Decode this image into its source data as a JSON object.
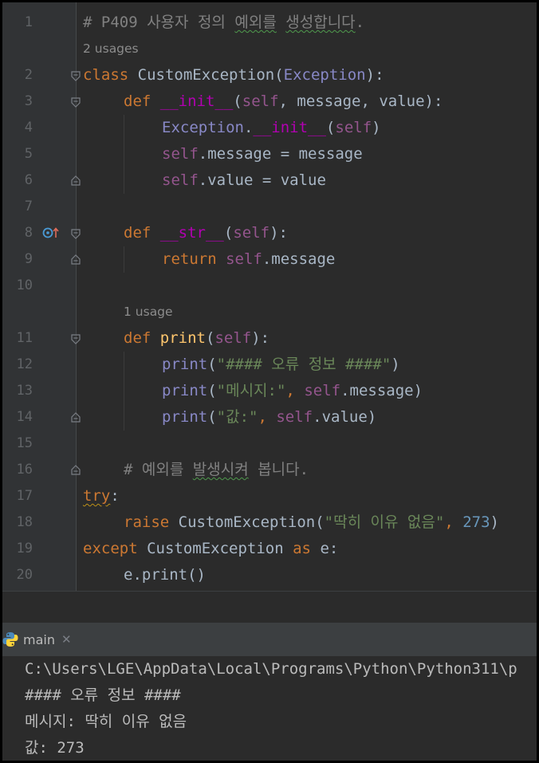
{
  "editor": {
    "line_numbers": [
      "1",
      "2",
      "3",
      "4",
      "5",
      "6",
      "7",
      "8",
      "9",
      "10",
      "11",
      "12",
      "13",
      "14",
      "15",
      "16",
      "17",
      "18",
      "19",
      "20"
    ],
    "lines": {
      "l1": {
        "comment_hash": "# P409 사용자 정의 ",
        "comment_squig": "예외를",
        "comment_rest": " ",
        "comment_squig2": "생성합니다",
        "comment_end": "."
      },
      "usage_a": "2 usages",
      "l2": {
        "kw": "class",
        "name": " CustomException(",
        "base": "Exception",
        "end": "):"
      },
      "l3": {
        "kw": "def",
        "sp": " ",
        "fn": "__init__",
        "open": "(",
        "self": "self",
        "rest": ", message, value):"
      },
      "l4": {
        "base": "Exception",
        "dot": ".",
        "fn": "__init__",
        "open": "(",
        "self": "self",
        "close": ")"
      },
      "l5": {
        "self": "self",
        "rest": ".message = message"
      },
      "l6": {
        "self": "self",
        "rest": ".value = value"
      },
      "l8": {
        "kw": "def",
        "sp": " ",
        "fn": "__str__",
        "open": "(",
        "self": "self",
        "close": "):"
      },
      "l9": {
        "kw": "return",
        "sp": " ",
        "self": "self",
        "rest": ".message"
      },
      "usage_b": "1 usage",
      "l11": {
        "kw": "def",
        "sp": " ",
        "fn": "print",
        "open": "(",
        "self": "self",
        "close": "):"
      },
      "l12": {
        "builtin": "print",
        "open": "(",
        "str": "\"#### 오류 정보 ####\"",
        "close": ")"
      },
      "l13": {
        "builtin": "print",
        "open": "(",
        "str": "\"메시지:\"",
        "mid": ", ",
        "self": "self",
        "rest": ".message)"
      },
      "l14": {
        "builtin": "print",
        "open": "(",
        "str": "\"값:\"",
        "mid": ", ",
        "self": "self",
        "rest": ".value)"
      },
      "l16": {
        "c1": "# 예외를 ",
        "c_squig": "발생시켜",
        "c2": " 봅니다."
      },
      "l17": {
        "kw": "try",
        "rest": ":"
      },
      "l18": {
        "kw": "raise",
        "mid": " CustomException(",
        "str": "\"딱히 이유 없음\"",
        "sep": ", ",
        "num": "273",
        "close": ")"
      },
      "l19": {
        "kw": "except",
        "mid": " CustomException ",
        "kw2": "as",
        "rest": " e:"
      },
      "l20": {
        "text": "e.print()"
      }
    }
  },
  "run_panel": {
    "tab_label": "main",
    "tab_icon": "python-icon",
    "close_icon": "close-icon",
    "output": [
      "C:\\Users\\LGE\\AppData\\Local\\Programs\\Python\\Python311\\p",
      "#### 오류 정보 ####",
      "메시지: 딱히 이유 없음",
      "값: 273"
    ]
  },
  "colors": {
    "keyword": "#cc7832",
    "magic_method": "#b200b2",
    "function": "#ffc66d",
    "self": "#94558d",
    "builtin": "#8888c6",
    "string": "#6a8759",
    "number": "#6897bb",
    "comment": "#808080",
    "background": "#2b2b2b"
  }
}
